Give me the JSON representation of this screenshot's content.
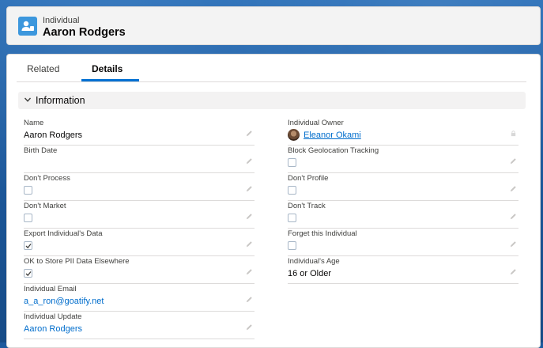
{
  "header": {
    "object_label": "Individual",
    "record_title": "Aaron Rodgers",
    "icon": "individual-icon"
  },
  "tabs": [
    {
      "label": "Related",
      "active": false
    },
    {
      "label": "Details",
      "active": true
    }
  ],
  "section": {
    "title": "Information",
    "icon": "chevron-down-icon"
  },
  "left_fields": [
    {
      "label": "Name",
      "value": "Aaron Rodgers",
      "type": "text"
    },
    {
      "label": "Birth Date",
      "value": "",
      "type": "text"
    },
    {
      "label": "Don't Process",
      "checked": false,
      "type": "checkbox"
    },
    {
      "label": "Don't Market",
      "checked": false,
      "type": "checkbox"
    },
    {
      "label": "Export Individual's Data",
      "checked": true,
      "type": "checkbox"
    },
    {
      "label": "OK to Store PII Data Elsewhere",
      "checked": true,
      "type": "checkbox"
    },
    {
      "label": "Individual Email",
      "value": "a_a_ron@goatify.net",
      "type": "link"
    },
    {
      "label": "Individual Update",
      "value": "Aaron Rodgers",
      "type": "link"
    }
  ],
  "right_fields": [
    {
      "label": "Individual Owner",
      "value": "Eleanor Okami",
      "type": "owner"
    },
    {
      "label": "Block Geolocation Tracking",
      "checked": false,
      "type": "checkbox"
    },
    {
      "label": "Don't Profile",
      "checked": false,
      "type": "checkbox"
    },
    {
      "label": "Don't Track",
      "checked": false,
      "type": "checkbox"
    },
    {
      "label": "Forget this Individual",
      "checked": false,
      "type": "checkbox"
    },
    {
      "label": "Individual's Age",
      "value": "16 or Older",
      "type": "text"
    }
  ],
  "colors": {
    "link": "#006dcc",
    "accent": "#0070d2",
    "object_icon": "#3c97dd"
  }
}
